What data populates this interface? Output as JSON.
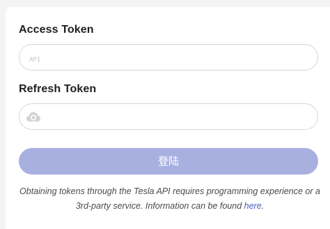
{
  "access_token": {
    "label": "Access Token",
    "placeholder": "API",
    "value": ""
  },
  "refresh_token": {
    "label": "Refresh Token",
    "placeholder": "",
    "value": "",
    "icon": "cloud-icon"
  },
  "login_button": {
    "label": "登陆"
  },
  "note": {
    "text": "Obtaining tokens through the Tesla API requires programming experience or a 3rd-party service. Information can be found",
    "link_text": "here",
    "suffix": "."
  },
  "colors": {
    "button_bg": "#a8b0e0",
    "link": "#4a5cc7",
    "input_border": "#d6d6d9"
  }
}
